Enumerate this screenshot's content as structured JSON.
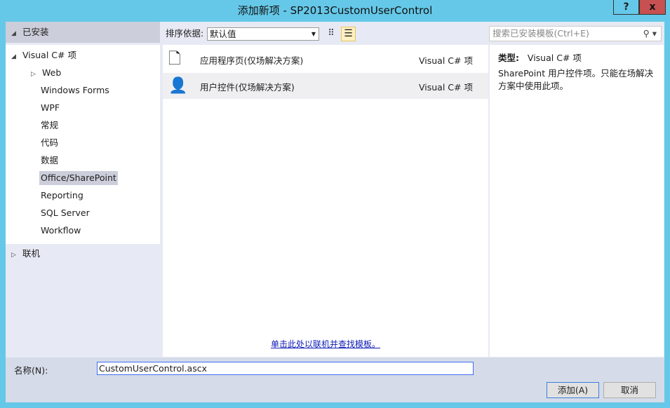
{
  "window": {
    "title": "添加新项 - SP2013CustomUserControl",
    "help_label": "?",
    "close_label": "x"
  },
  "left": {
    "installed_label": "已安装",
    "root": "Visual C# 项",
    "items": [
      {
        "label": "Web",
        "expandable": true
      },
      {
        "label": "Windows Forms"
      },
      {
        "label": "WPF"
      },
      {
        "label": "常规"
      },
      {
        "label": "代码"
      },
      {
        "label": "数据"
      },
      {
        "label": "Office/SharePoint",
        "selected": true
      },
      {
        "label": "Reporting"
      },
      {
        "label": "SQL Server"
      },
      {
        "label": "Workflow"
      }
    ],
    "online_label": "联机"
  },
  "toolbar": {
    "sort_label": "排序依据:",
    "sort_value": "默认值",
    "search_placeholder": "搜索已安装模板(Ctrl+E)"
  },
  "templates": [
    {
      "name": "应用程序页(仅场解决方案)",
      "type": "Visual C# 项",
      "icon": "application-page-icon"
    },
    {
      "name": "用户控件(仅场解决方案)",
      "type": "Visual C# 项",
      "icon": "user-control-icon",
      "selected": true
    }
  ],
  "online_link": "单击此处以联机并查找模板。",
  "details": {
    "type_label": "类型:",
    "type_value": "Visual C# 项",
    "description": "SharePoint 用户控件项。只能在场解决方案中使用此项。"
  },
  "name_field": {
    "label": "名称(N):",
    "value": "CustomUserControl.ascx"
  },
  "buttons": {
    "add": "添加(A)",
    "cancel": "取消"
  }
}
